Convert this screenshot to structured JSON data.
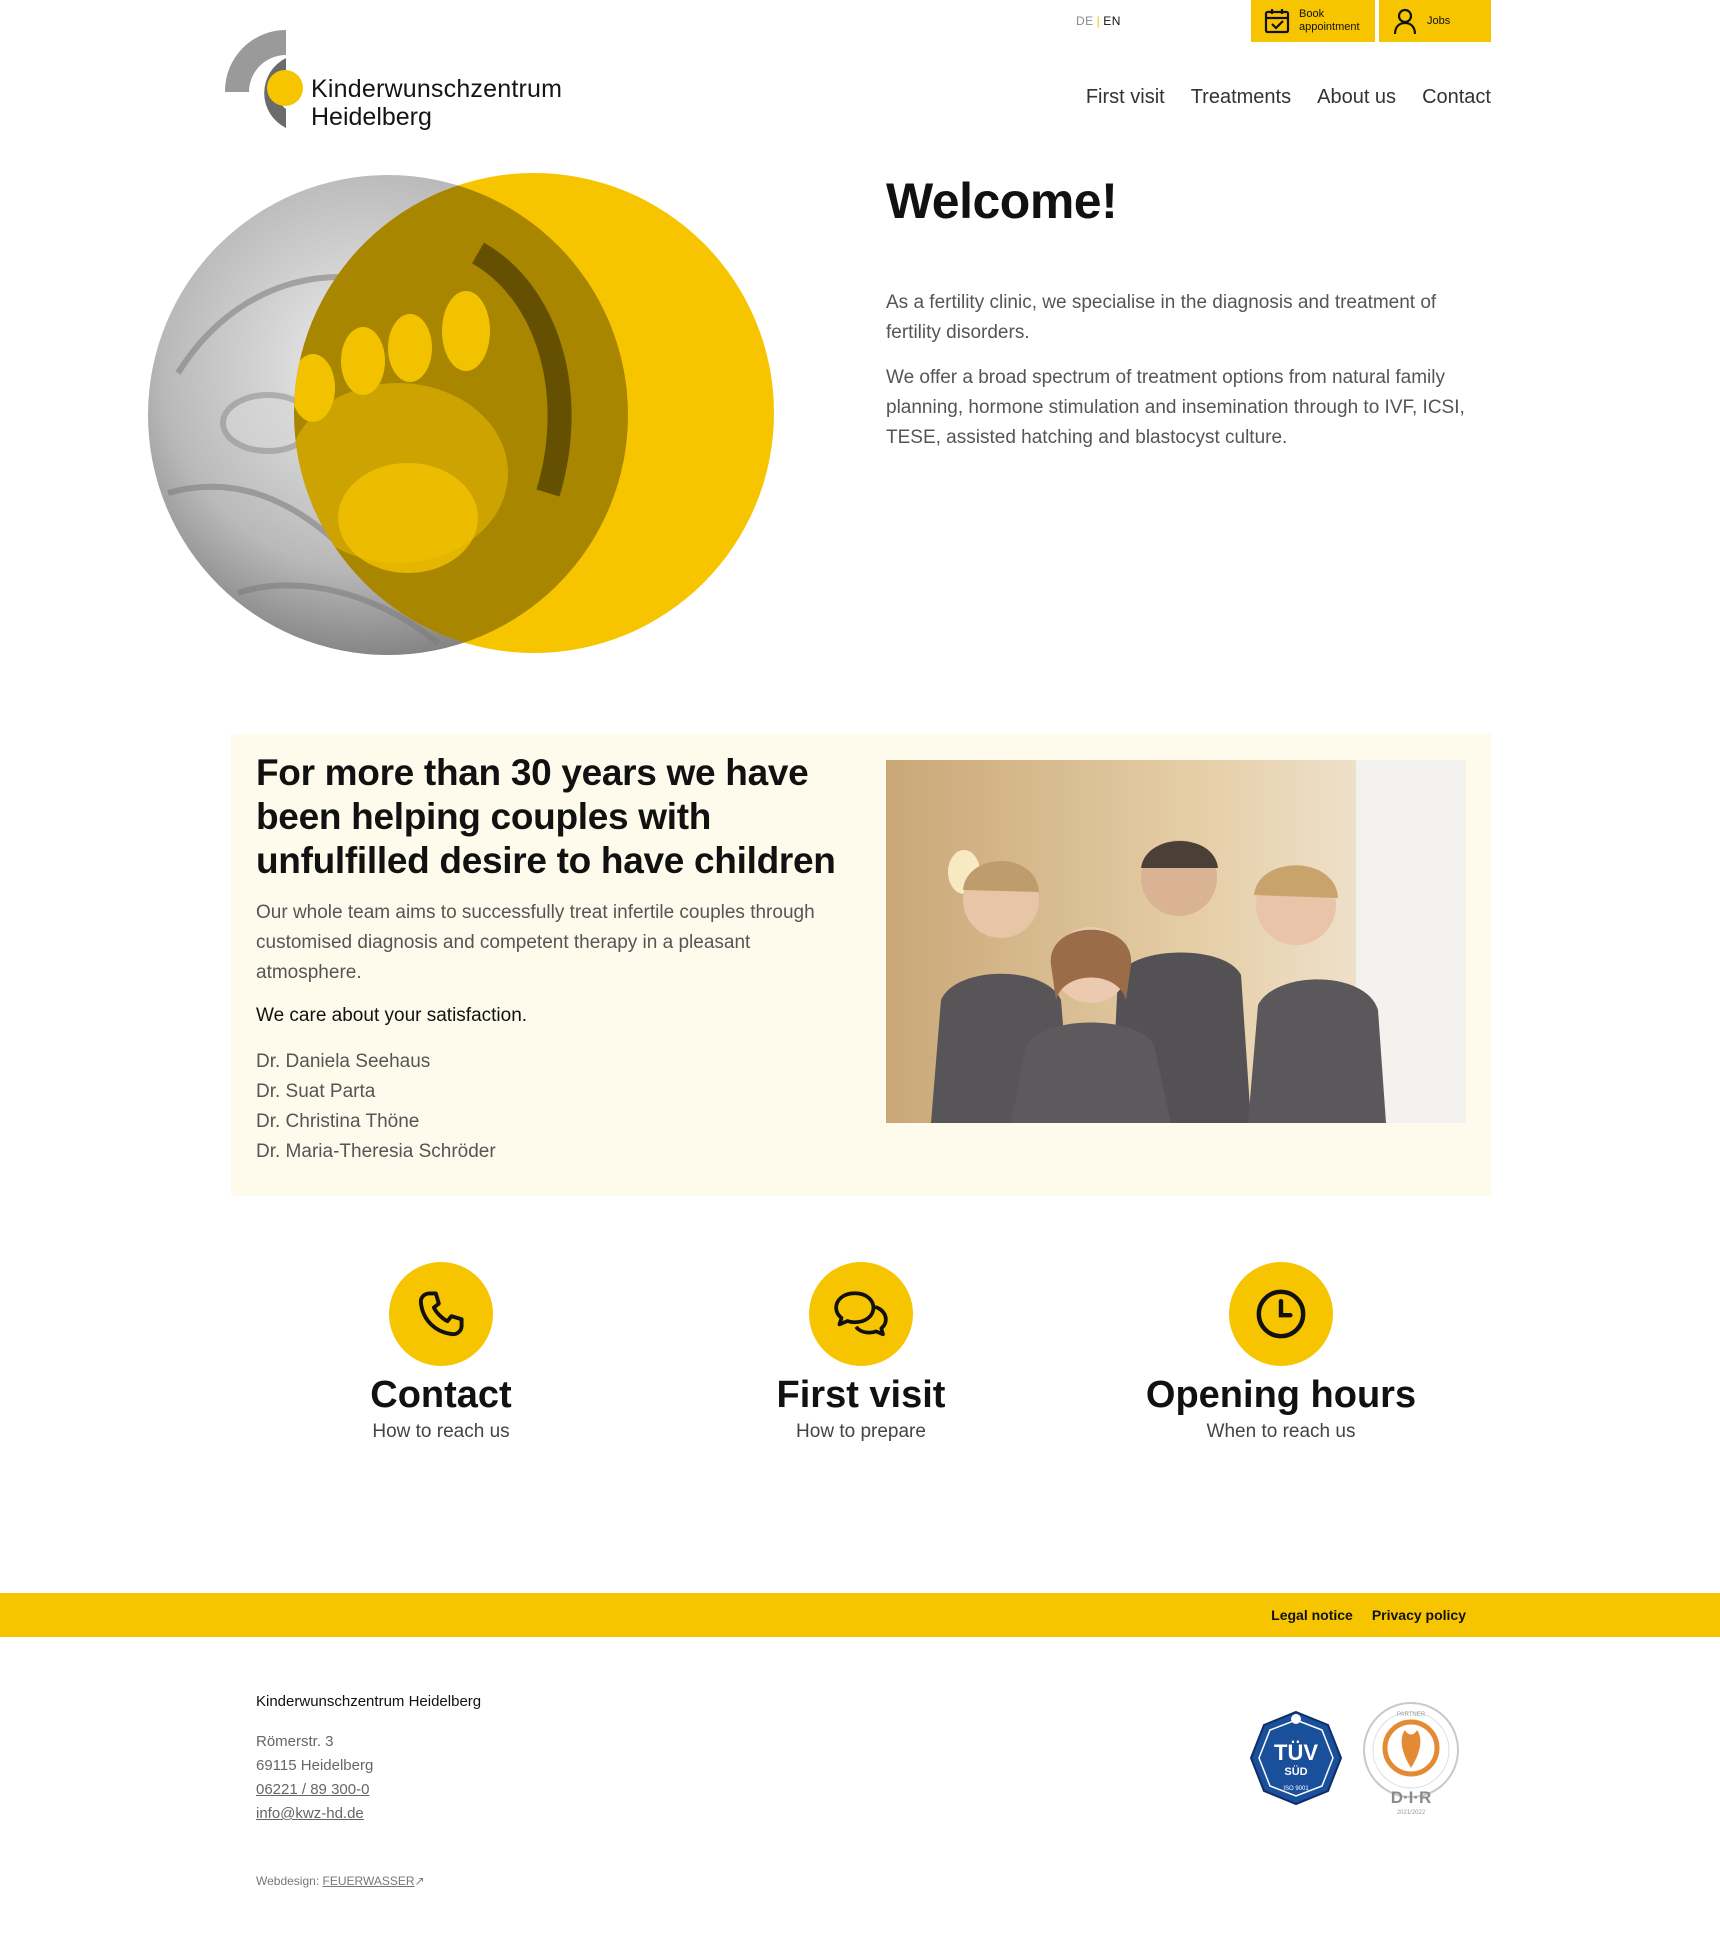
{
  "header": {
    "lang": {
      "de": "DE",
      "sep": "|",
      "en": "EN"
    },
    "book_label": "Book appointment",
    "jobs_label": "Jobs",
    "logo": {
      "line1": "Kinderwunschzentrum",
      "line2": "Heidelberg"
    },
    "nav": [
      "First visit",
      "Treatments",
      "About us",
      "Contact"
    ]
  },
  "hero": {
    "title": "Welcome!",
    "p1": "As a fertility clinic, we specialise in the diagnosis and treatment of fertility disorders.",
    "p2": "We offer a broad spectrum of treatment options from natural family planning, hormone stimulation and insemination through to IVF, ICSI, TESE, assisted hatching and blastocyst culture."
  },
  "team": {
    "title": "For more than 30 years we have been helping couples with unfulfilled desire to have children",
    "intro": "Our whole team aims to successfully treat infertile couples through customised diagnosis and competent therapy in a pleasant atmosphere.",
    "care": "We care about your satisfaction.",
    "doctors": [
      "Dr. Daniela Seehaus",
      "Dr. Suat Parta",
      "Dr. Christina Thöne",
      "Dr. Maria-Theresia Schröder"
    ]
  },
  "features": [
    {
      "icon": "phone-icon",
      "title": "Contact",
      "subtitle": "How to reach us"
    },
    {
      "icon": "chat-icon",
      "title": "First visit",
      "subtitle": "How to prepare"
    },
    {
      "icon": "clock-icon",
      "title": "Opening hours",
      "subtitle": "When to reach us"
    }
  ],
  "footer": {
    "links": [
      "Legal notice",
      "Privacy policy"
    ],
    "name": "Kinderwunschzentrum Heidelberg",
    "street": "Römerstr. 3",
    "city": "69115 Heidelberg",
    "phone": "06221 / 89 300-0",
    "email": "info@kwz-hd.de",
    "credit_label": "Webdesign:",
    "credit_link": "FEUERWASSER",
    "tuv": {
      "top": "TÜV",
      "sub": "SÜD",
      "iso": "ISO 9001"
    },
    "dir": {
      "letters": "D·I·R",
      "ring_top": "PARTNER",
      "years": "2021/2022"
    }
  },
  "colors": {
    "accent": "#f7c500",
    "cream": "#fffbec",
    "grey_logo": "#8c8c8c"
  }
}
